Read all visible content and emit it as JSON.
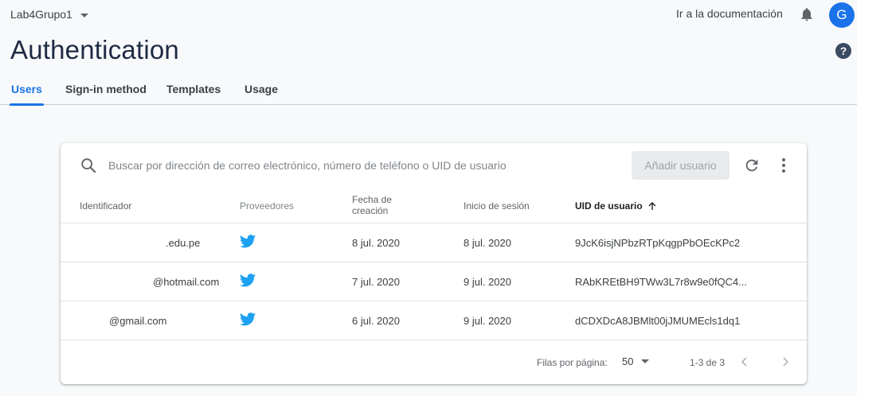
{
  "topbar": {
    "project_name": "Lab4Grupo1",
    "doc_link": "Ir a la documentación",
    "avatar_letter": "G"
  },
  "page": {
    "title": "Authentication",
    "help_glyph": "?"
  },
  "tabs": [
    {
      "label": "Users",
      "active": true
    },
    {
      "label": "Sign-in method",
      "active": false
    },
    {
      "label": "Templates",
      "active": false
    },
    {
      "label": "Usage",
      "active": false
    }
  ],
  "toolbar": {
    "search_placeholder": "Buscar por dirección de correo electrónico, número de teléfono o UID de usuario",
    "add_user_label": "Añadir usuario"
  },
  "table": {
    "columns": {
      "identifier": "Identificador",
      "providers": "Proveedores",
      "created_line1": "Fecha de",
      "created_line2": "creación",
      "signed_in": "Inicio de sesión",
      "uid": "UID de usuario"
    },
    "rows": [
      {
        "identifier": ".edu.pe",
        "provider": "twitter-icon",
        "created": "8 jul. 2020",
        "signed_in": "8 jul. 2020",
        "uid": "9JcK6isjNPbzRTpKqgpPbOEcKPc2"
      },
      {
        "identifier": "@hotmail.com",
        "provider": "twitter-icon",
        "created": "7 jul. 2020",
        "signed_in": "9 jul. 2020",
        "uid": "RAbKREtBH9TWw3L7r8w9e0fQC4..."
      },
      {
        "identifier": "@gmail.com",
        "provider": "twitter-icon",
        "created": "6 jul. 2020",
        "signed_in": "9 jul. 2020",
        "uid": "dCDXDcA8JBMlt00jJMUMEcls1dq1"
      }
    ]
  },
  "pagination": {
    "rows_per_page_label": "Filas por página:",
    "rows_per_page_value": "50",
    "range": "1-3 de 3"
  },
  "colors": {
    "accent": "#1a73e8",
    "twitter": "#1da1f2",
    "title": "#1f2a44"
  }
}
